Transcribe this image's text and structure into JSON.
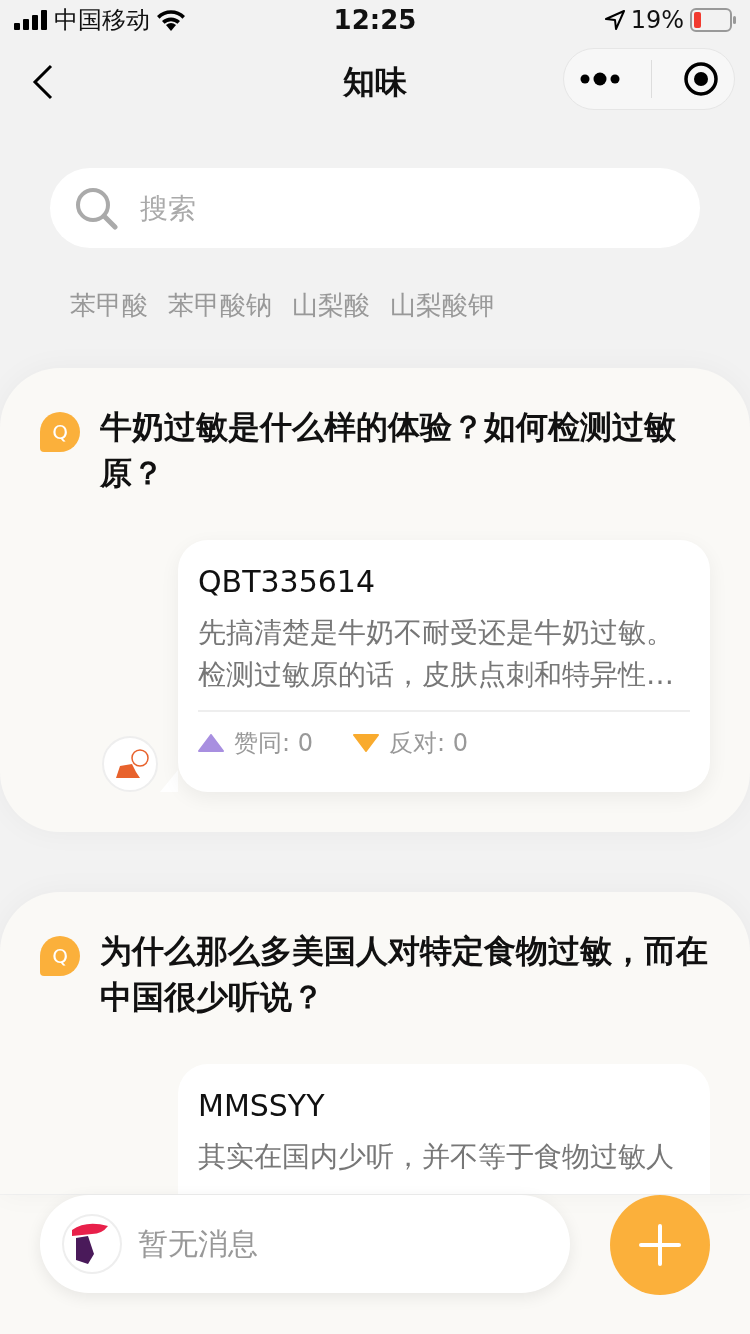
{
  "status_bar": {
    "carrier": "中国移动",
    "time": "12:25",
    "battery": "19%"
  },
  "nav": {
    "title": "知味"
  },
  "search": {
    "placeholder": "搜索"
  },
  "tags": [
    "苯甲酸",
    "苯甲酸钠",
    "山梨酸",
    "山梨酸钾"
  ],
  "questions": [
    {
      "badge": "Q",
      "title": "牛奶过敏是什么样的体验？如何检测过敏原？",
      "answer": {
        "author": "QBT335614",
        "body": "先搞清楚是牛奶不耐受还是牛奶过敏。检测过敏原的话，皮肤点刺和特异性…",
        "votes": [
          {
            "kind": "up",
            "label": "赞同: 0"
          },
          {
            "kind": "down",
            "label": "反对: 0"
          }
        ]
      }
    },
    {
      "badge": "Q",
      "title": "为什么那么多美国人对特定食物过敏，而在中国很少听说？",
      "answer": {
        "author": "MMSSYY",
        "body": "其实在国内少听，并不等于食物过敏人"
      }
    }
  ],
  "message_bar": {
    "placeholder": "暂无消息"
  }
}
